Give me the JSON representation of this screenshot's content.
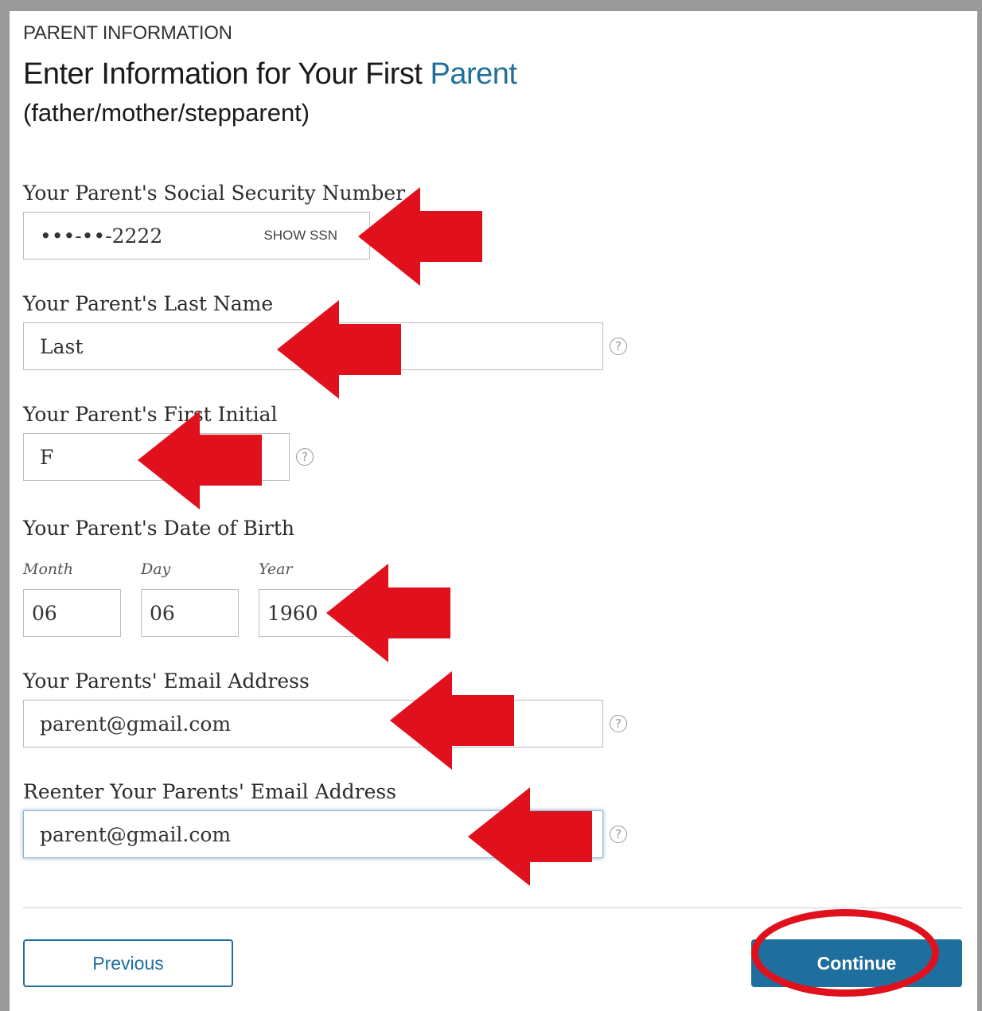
{
  "colors": {
    "accent": "#1f6f9e",
    "annotation": "#e0111c"
  },
  "header": {
    "section_label": "PARENT INFORMATION",
    "title_main": "Enter Information for Your First ",
    "title_accent": "Parent",
    "subtitle": "(father/mother/stepparent)"
  },
  "ssn": {
    "label": "Your Parent's Social Security Number",
    "value": "•••-••-2222",
    "toggle": "SHOW SSN"
  },
  "last_name": {
    "label": "Your Parent's Last Name",
    "value": "Last"
  },
  "first_initial": {
    "label": "Your Parent's First Initial",
    "value": "F"
  },
  "dob": {
    "label": "Your Parent's Date of Birth",
    "month_label": "Month",
    "month_value": "06",
    "day_label": "Day",
    "day_value": "06",
    "year_label": "Year",
    "year_value": "1960"
  },
  "email": {
    "label": "Your Parents' Email Address",
    "value": "parent@gmail.com"
  },
  "email_confirm": {
    "label": "Reenter Your Parents' Email Address",
    "value": "parent@gmail.com"
  },
  "help_glyph": "?",
  "buttons": {
    "previous": "Previous",
    "continue": "Continue"
  }
}
